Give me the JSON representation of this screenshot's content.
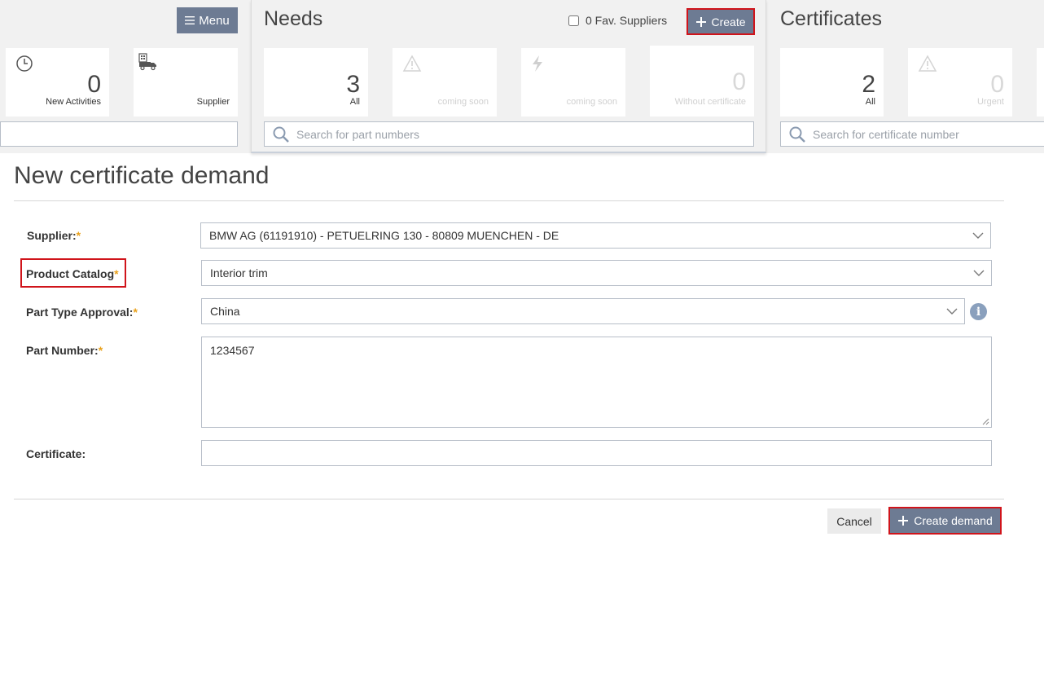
{
  "left_panel": {
    "menu_label": "Menu",
    "tiles": [
      {
        "value": "0",
        "label": "New Activities",
        "icon": "clock-icon"
      },
      {
        "value": "",
        "label": "Supplier",
        "icon": "supplier-truck-icon"
      }
    ]
  },
  "needs": {
    "title": "Needs",
    "fav_suppliers_label": "0 Fav. Suppliers",
    "create_label": "Create",
    "tiles": [
      {
        "value": "3",
        "label": "All"
      },
      {
        "value": "",
        "label": "coming soon",
        "icon": "warning-icon"
      },
      {
        "value": "",
        "label": "coming soon",
        "icon": "lightning-icon"
      },
      {
        "value": "0",
        "label": "Without certificate"
      }
    ],
    "search_placeholder": "Search for part numbers"
  },
  "certificates": {
    "title": "Certificates",
    "tiles": [
      {
        "value": "2",
        "label": "All"
      },
      {
        "value": "0",
        "label": "Urgent",
        "icon": "warning-icon"
      }
    ],
    "search_placeholder": "Search for certificate number"
  },
  "form": {
    "title": "New certificate demand",
    "required_mark": "*",
    "supplier": {
      "label": "Supplier:",
      "value": "BMW AG (61191910) - PETUELRING 130 - 80809 MUENCHEN - DE"
    },
    "product_catalog": {
      "label": "Product Catalog",
      "value": "Interior trim"
    },
    "part_type_approval": {
      "label": "Part Type Approval:",
      "value": "China"
    },
    "part_number": {
      "label": "Part Number:",
      "value": "1234567"
    },
    "certificate": {
      "label": "Certificate:",
      "value": ""
    },
    "info_glyph": "i",
    "cancel_label": "Cancel",
    "create_demand_label": "Create demand"
  },
  "colors": {
    "accent": "#6d7b93",
    "highlight": "#d0141b",
    "required": "#e9a11b"
  }
}
